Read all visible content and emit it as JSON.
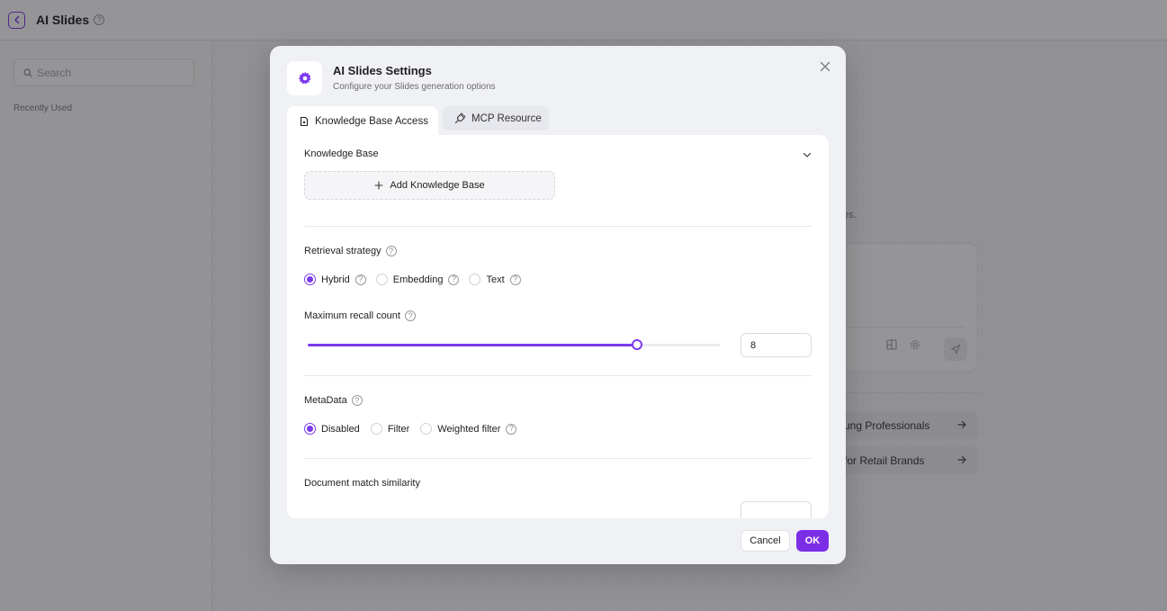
{
  "app": {
    "title": "AI Slides",
    "help_glyph": "?",
    "search_placeholder": "Search",
    "recently_used": "Recently Used"
  },
  "background": {
    "hint_text": "es.",
    "suggestions": [
      {
        "label": "ung Professionals"
      },
      {
        "label": "for Retail Brands"
      }
    ]
  },
  "modal": {
    "title": "AI Slides Settings",
    "subtitle": "Configure your Slides generation options",
    "tabs": [
      {
        "label": "Knowledge Base Access",
        "icon": "knowledge-base-icon",
        "active": true
      },
      {
        "label": "MCP Resource",
        "icon": "plug-icon",
        "active": false
      }
    ],
    "knowledge_base": {
      "label": "Knowledge Base",
      "add_button": "Add Knowledge Base"
    },
    "retrieval_strategy": {
      "label": "Retrieval strategy",
      "options": [
        {
          "label": "Hybrid",
          "selected": true
        },
        {
          "label": "Embedding",
          "selected": false
        },
        {
          "label": "Text",
          "selected": false
        }
      ]
    },
    "max_recall": {
      "label": "Maximum recall count",
      "value": "8",
      "slider_fraction": 0.8
    },
    "metadata": {
      "label": "MetaData",
      "options": [
        {
          "label": "Disabled",
          "selected": true
        },
        {
          "label": "Filter",
          "selected": false
        },
        {
          "label": "Weighted filter",
          "selected": false
        }
      ]
    },
    "doc_similarity": {
      "label": "Document match similarity"
    },
    "buttons": {
      "cancel": "Cancel",
      "ok": "OK"
    }
  },
  "colors": {
    "accent": "#7c3aed",
    "ok_button": "#7c2ee6"
  }
}
